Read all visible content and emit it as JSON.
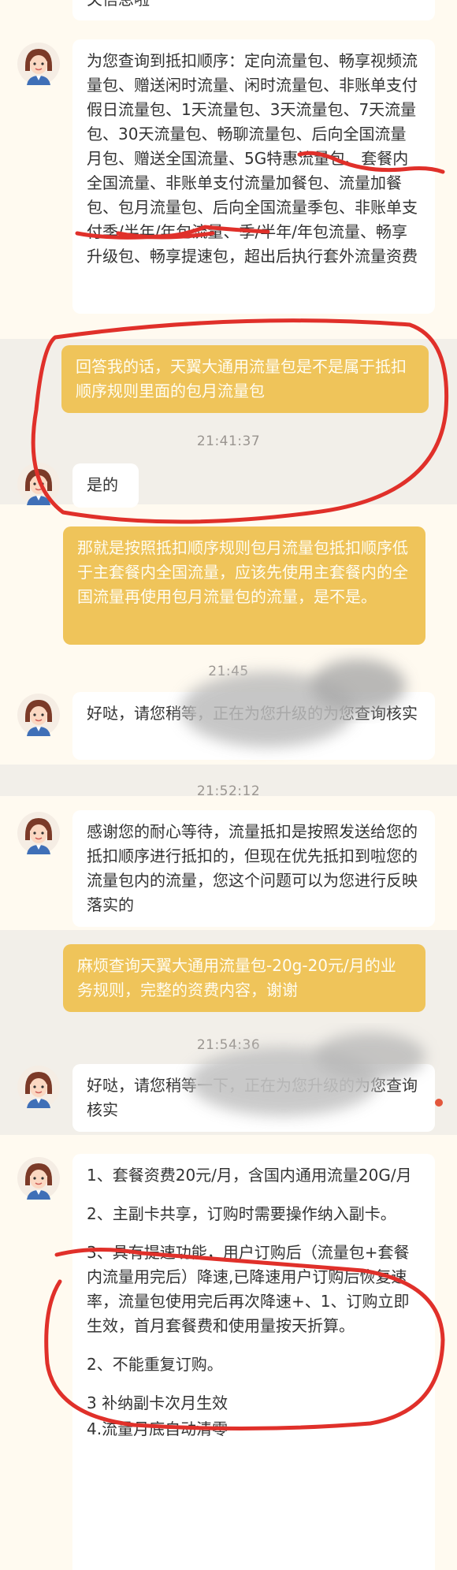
{
  "top_partial_text": "关信息啦",
  "messages": {
    "m1": "为您查询到抵扣顺序：定向流量包、畅享视频流量包、赠送闲时流量、闲时流量包、非账单支付假日流量包、1天流量包、3天流量包、7天流量包、30天流量包、畅聊流量包、后向全国流量月包、赠送全国流量、5G特惠流量包、套餐内全国流量、非账单支付流量加餐包、流量加餐包、包月流量包、后向全国流量季包、非账单支付季/半年/年包流量、季/半年/年包流量、畅享升级包、畅享提速包，超出后执行套外流量资费",
    "m2": "回答我的话，天翼大通用流量包是不是属于抵扣顺序规则里面的包月流量包",
    "m3": "是的",
    "m4": "那就是按照抵扣顺序规则包月流量包抵扣顺序低于主套餐内全国流量，应该先使用主套餐内的全国流量再使用包月流量包的流量，是不是。",
    "m5": "好哒，请您稍等，正在为您升级的为您查询核实",
    "m6": "感谢您的耐心等待，流量抵扣是按照发送给您的抵扣顺序进行抵扣的，但现在优先抵扣到啦您的流量包内的流量，您这个问题可以为您进行反映落实的",
    "m7": "麻烦查询天翼大通用流量包-20g-20元/月的业务规则，完整的资费内容，谢谢",
    "m8": "好哒，请您稍等一下，正在为您升级的为您查询核实",
    "m9": {
      "p1": "1、套餐资费20元/月，含国内通用流量20G/月",
      "p2": "2、主副卡共享，订购时需要操作纳入副卡。",
      "p3": "3、具有提速功能，用户订购后（流量包+套餐内流量用完后）降速,已降速用户订购后恢复速率，流量包使用完后再次降速+、1、订购立即生效，首月套餐费和使用量按天折算。",
      "p4": "2、不能重复订购。",
      "p5": "3 补纳副卡次月生效",
      "p6": "4.流量月底自动清零"
    }
  },
  "timestamps": {
    "t1": "21:41:37",
    "t2": "21:45",
    "t3": "21:52:12",
    "t4": "21:54:36"
  },
  "colors": {
    "page_bg": "#f2efe9",
    "agent_bubble": "#ffffff",
    "user_bubble": "#efc45a",
    "ink": "#e0302a"
  }
}
